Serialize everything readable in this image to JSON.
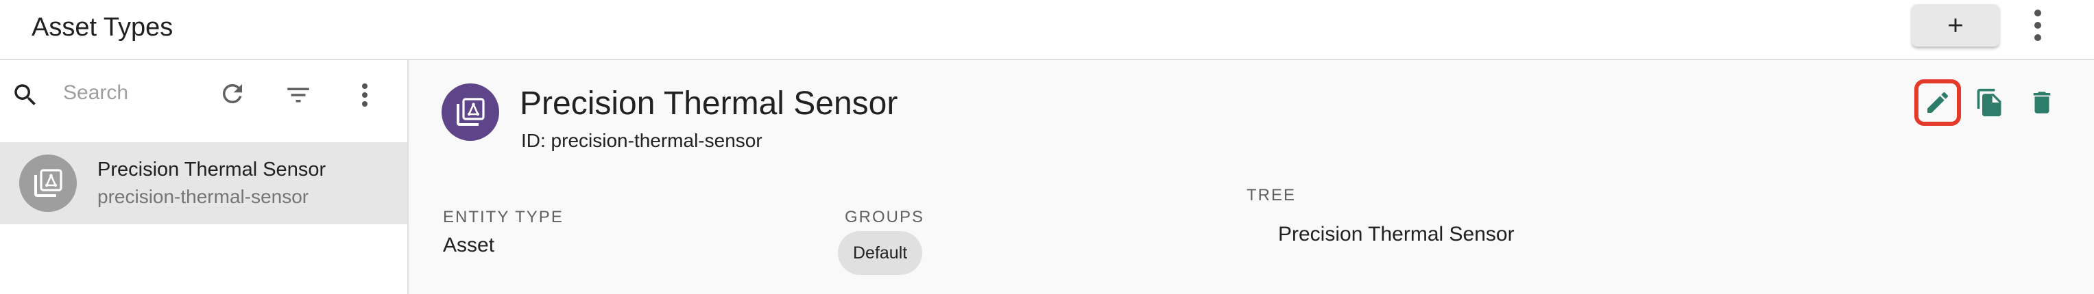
{
  "header": {
    "title": "Asset Types",
    "add_label": "+",
    "icons": {
      "add": "plus-icon",
      "more": "more-vert-icon"
    }
  },
  "sidebar": {
    "search": {
      "placeholder": "Search",
      "value": ""
    },
    "icons": {
      "search": "search-icon",
      "refresh": "refresh-icon",
      "filter": "filter-icon",
      "more": "more-vert-icon"
    },
    "items": [
      {
        "title": "Precision Thermal Sensor",
        "subtitle": "precision-thermal-sensor",
        "selected": true
      }
    ]
  },
  "detail": {
    "title": "Precision Thermal Sensor",
    "id_line": "ID: precision-thermal-sensor",
    "actions": {
      "edit": "edit-icon",
      "copy": "copy-icon",
      "delete": "delete-icon"
    },
    "fields": {
      "entity_type_label": "ENTITY TYPE",
      "entity_type_value": "Asset",
      "groups_label": "GROUPS",
      "groups": [
        "Default"
      ],
      "tree_label": "TREE",
      "tree_value": "Precision Thermal Sensor"
    }
  },
  "colors": {
    "accent": "#2e7d6b",
    "avatar_purple": "#5e4589",
    "avatar_gray": "#9e9e9e",
    "highlight": "#e5392b"
  }
}
